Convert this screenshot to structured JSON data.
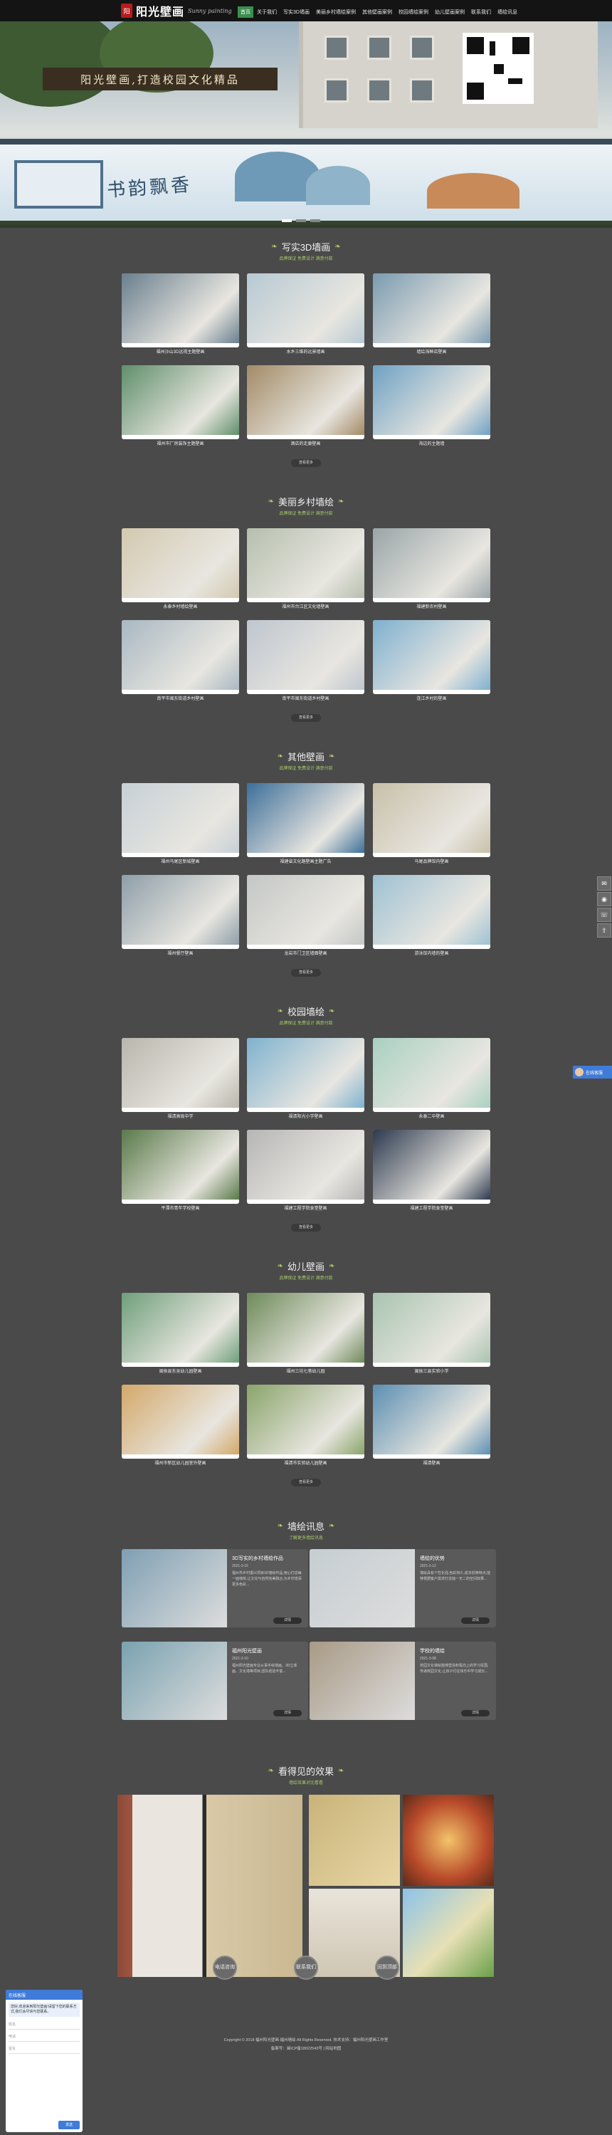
{
  "header": {
    "logo_text": "阳光壁画",
    "logo_sub": "Sunny painting",
    "nav": [
      "首页",
      "关于我们",
      "写实3D墙画",
      "美丽乡村墙绘案例",
      "其他壁画案例",
      "校园墙绘案例",
      "幼儿壁画案例",
      "联系我们",
      "墙绘讯息"
    ]
  },
  "hero": {
    "banner_text": "阳光壁画,打造校园文化精品",
    "mural_text": "书韵飘香"
  },
  "sections": [
    {
      "title": "写实3D墙画",
      "subtitle": "品牌保证 免费设计 满意付款",
      "more": "查看更多",
      "items": [
        "福州沙山3D远视主题壁画",
        "水乡三维的远景墙画",
        "墙绘海鲜店壁画",
        "福州市厂房装饰主题壁画",
        "酒店的走廊壁画",
        "海边的主题墙"
      ]
    },
    {
      "title": "美丽乡村墙绘",
      "subtitle": "品牌保证 免费设计 满意付款",
      "more": "查看更多",
      "items": [
        "永泰乡村墙绘壁画",
        "福州市台江区文化墙壁画",
        "福建新农村壁画",
        "南平市闽东街道乡村壁画",
        "南平市闽东街道乡村壁画",
        "连江乡村的壁画"
      ]
    },
    {
      "title": "其他壁画",
      "subtitle": "品牌保证 免费设计 满意付款",
      "more": "查看更多",
      "items": [
        "福州马尾区新城壁画",
        "福建省文化路壁画主题广告",
        "马尾品牌馆内壁画",
        "福州餐厅壁画",
        "龙岩市门卫区墙面壁画",
        "游泳馆内墙的壁画"
      ]
    },
    {
      "title": "校园墙绘",
      "subtitle": "品牌保证 免费设计 满意付款",
      "more": "查看更多",
      "items": [
        "福清高级中学",
        "福清阳光小学壁画",
        "永泰二中壁画",
        "平潭市青年学校壁画",
        "福建工程学院食堂壁画",
        "福建工程学院食堂壁画"
      ]
    },
    {
      "title": "幼儿壁画",
      "subtitle": "品牌保证 免费设计 满意付款",
      "more": "查看更多",
      "items": [
        "闽侯县东吴幼儿园壁画",
        "福州三坊七巷幼儿园",
        "闽侯三县实验小学",
        "福州市新区幼儿园室外壁画",
        "福清市实验幼儿园壁画",
        "福清壁画"
      ]
    }
  ],
  "news": {
    "title": "墙绘讯息",
    "subtitle": "了解更多墙绘讯息",
    "more": "详情",
    "items": [
      {
        "title": "3D写实的乡村墙绘作品",
        "date": "2021-3-15",
        "text": "福州市乡村振兴项目3D墙绘作品,用心打造每一面墙体,让文化与自然完美融合,为乡村增添更多色彩..."
      },
      {
        "title": "墙绘的优势",
        "date": "2021-3-12",
        "text": "墙绘具有个性化强,色彩持久,成本低等特点,能够根据客户需求打造独一无二的空间效果..."
      },
      {
        "title": "福州阳光壁画",
        "date": "2021-3-10",
        "text": "福州阳光壁画专业从事手绘墙画、3D立体画、文化墙等项目,团队经验丰富..."
      },
      {
        "title": "学校的墙绘",
        "date": "2021-3-08",
        "text": "校园文化墙绘能够营造积极向上的学习氛围,传递校园文化,让孩子们在快乐中学习成长..."
      }
    ]
  },
  "effect": {
    "title": "看得见的效果",
    "subtitle": "墙绘效果对比看看"
  },
  "footer": {
    "btns": [
      "电话咨询",
      "联系我们",
      "回到顶部"
    ],
    "copyright": "Copyright © 2018 福州阳光壁画 福州墙绘 All Rights Reserved.  技术支持：福州阳光壁画工作室",
    "icp": "备案号：闽ICP备18022543号  |  网站地图"
  },
  "side_service": "在线客服",
  "chat": {
    "header": "在线客服",
    "message": "您好,欢迎来到阳光壁画!请留下您的联系方式,我们会尽快与您联系。",
    "fields": [
      "姓名",
      "电话",
      "留言"
    ],
    "send": "发送"
  }
}
